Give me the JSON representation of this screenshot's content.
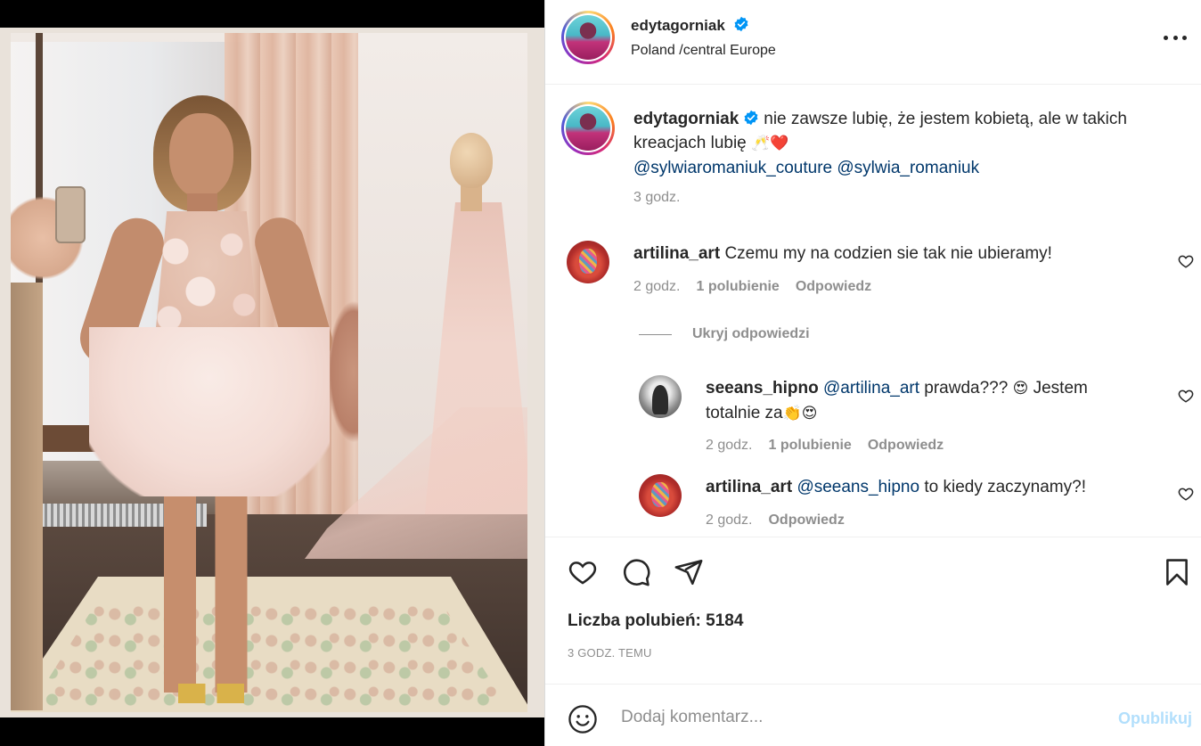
{
  "post": {
    "author": {
      "username": "edytagorniak",
      "location": "Poland /central Europe"
    },
    "caption": {
      "username": "edytagorniak",
      "text": "nie zawsze lubię, że jestem kobietą, ale w takich",
      "text_line2": "kreacjach lubię",
      "emojis": "🥂❤️",
      "mention1": "@sylwiaromaniuk_couture",
      "mention2": "@sylwia_romaniuk",
      "time": "3 godz."
    },
    "comments": [
      {
        "username": "artilina_art",
        "text": "Czemu my na codzien sie tak nie ubieramy!",
        "time": "2 godz.",
        "likes": "1 polubienie",
        "reply_label": "Odpowiedz"
      }
    ],
    "hide_replies_label": "Ukryj odpowiedzi",
    "replies": [
      {
        "username": "seeans_hipno",
        "mention": "@artilina_art",
        "text": "prawda???",
        "emoji1": "😍",
        "text2": "Jestem",
        "text_line2": "totalnie za",
        "emoji2": "👏😍",
        "time": "2 godz.",
        "likes": "1 polubienie",
        "reply_label": "Odpowiedz"
      },
      {
        "username": "artilina_art",
        "mention": "@seeans_hipno",
        "text": "to kiedy zaczynamy?!",
        "time": "2 godz.",
        "reply_label": "Odpowiedz"
      }
    ],
    "likes_text": "Liczba polubień: 5184",
    "time_ago": "3 GODZ. TEMU",
    "add_comment": {
      "placeholder": "Dodaj komentarz...",
      "publish_label": "Opublikuj"
    },
    "colors": {
      "verified": "#0095f6",
      "mention": "#00376b",
      "muted": "#8e8e8e",
      "publish_disabled": "#b2dffc"
    },
    "icons": [
      "more-options-icon",
      "verified-badge-icon",
      "like-icon",
      "comment-icon",
      "share-icon",
      "save-icon",
      "emoji-icon"
    ]
  }
}
